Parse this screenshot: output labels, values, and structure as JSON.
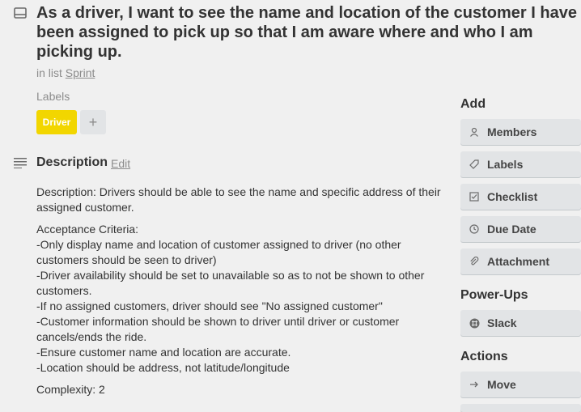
{
  "card": {
    "title": "As a driver, I want to see the name and location of the customer I have been assigned to pick up so that I am aware where and who I am picking up.",
    "in_list_prefix": "in list",
    "list_name": "Sprint"
  },
  "labels": {
    "heading": "Labels",
    "items": [
      {
        "text": "Driver",
        "color": "#f2d600"
      }
    ],
    "add_symbol": "+"
  },
  "description": {
    "heading": "Description",
    "edit_label": "Edit",
    "paragraph1": "Description: Drivers should be able to see the name and specific address of their assigned customer.",
    "criteria_lines": [
      "Acceptance Criteria:",
      "-Only display name and location of customer assigned to driver (no other customers should be seen to driver)",
      "-Driver availability should be set to unavailable so as to not be shown to other customers.",
      "-If no assigned customers, driver should see \"No assigned customer\"",
      "-Customer information should be shown to driver until driver or customer cancels/ends the ride.",
      "-Ensure customer name and location are accurate.",
      "-Location should be address, not latitude/longitude"
    ],
    "complexity": "Complexity: 2"
  },
  "sidebar": {
    "add_heading": "Add",
    "add_buttons": [
      {
        "label": "Members",
        "icon": "person-icon"
      },
      {
        "label": "Labels",
        "icon": "tag-icon"
      },
      {
        "label": "Checklist",
        "icon": "checkbox-icon"
      },
      {
        "label": "Due Date",
        "icon": "clock-icon"
      },
      {
        "label": "Attachment",
        "icon": "paperclip-icon"
      }
    ],
    "powerups_heading": "Power-Ups",
    "powerup_buttons": [
      {
        "label": "Slack",
        "icon": "slack-icon"
      }
    ],
    "actions_heading": "Actions",
    "action_buttons": [
      {
        "label": "Move",
        "icon": "arrow-right-icon"
      }
    ]
  }
}
